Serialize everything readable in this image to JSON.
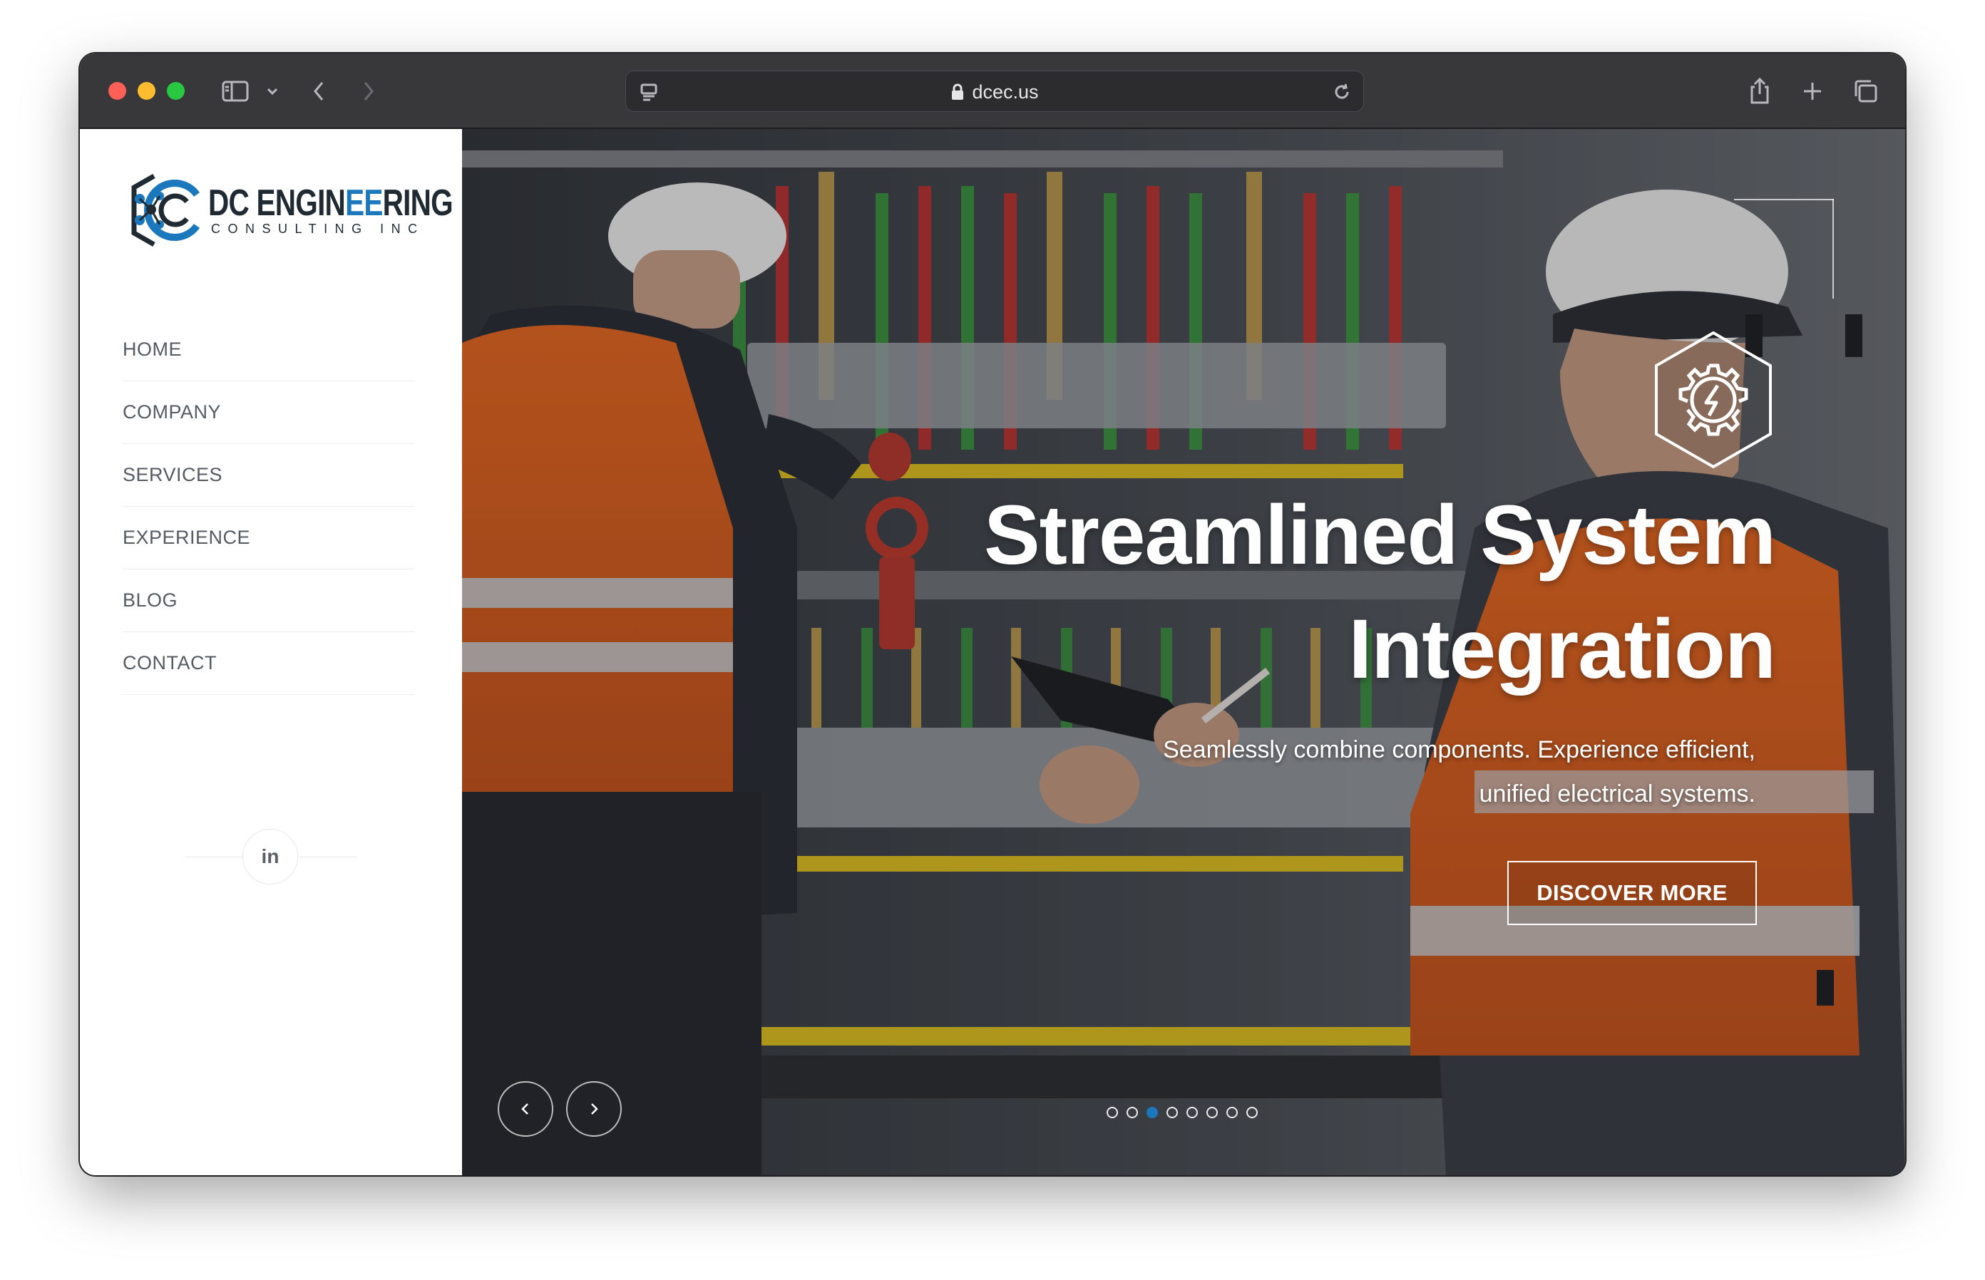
{
  "browser": {
    "url": "dcec.us",
    "icons": [
      "sidebar-toggle-icon",
      "chevron-down-icon",
      "back-icon",
      "forward-icon",
      "reader-icon",
      "lock-icon",
      "reload-icon",
      "share-icon",
      "new-tab-icon",
      "tabs-icon"
    ]
  },
  "brand": {
    "name_part1": "DC ENGIN",
    "name_part2": "EE",
    "name_part3": "RING",
    "subtitle": "CONSULTING INC",
    "accent_color": "#1c78bd",
    "dark_color": "#1f2a33"
  },
  "nav": {
    "items": [
      {
        "label": "HOME"
      },
      {
        "label": "COMPANY"
      },
      {
        "label": "SERVICES"
      },
      {
        "label": "EXPERIENCE"
      },
      {
        "label": "BLOG"
      },
      {
        "label": "CONTACT"
      }
    ]
  },
  "social": {
    "linkedin": "in"
  },
  "hero": {
    "title_line1": "Streamlined System",
    "title_line2": "Integration",
    "subtitle_line1": "Seamlessly combine components. Experience efficient,",
    "subtitle_line2": "unified electrical systems.",
    "cta_label": "DISCOVER MORE",
    "badge_icon": "gear-lightning-icon",
    "slide_count": 8,
    "active_slide": 3
  }
}
